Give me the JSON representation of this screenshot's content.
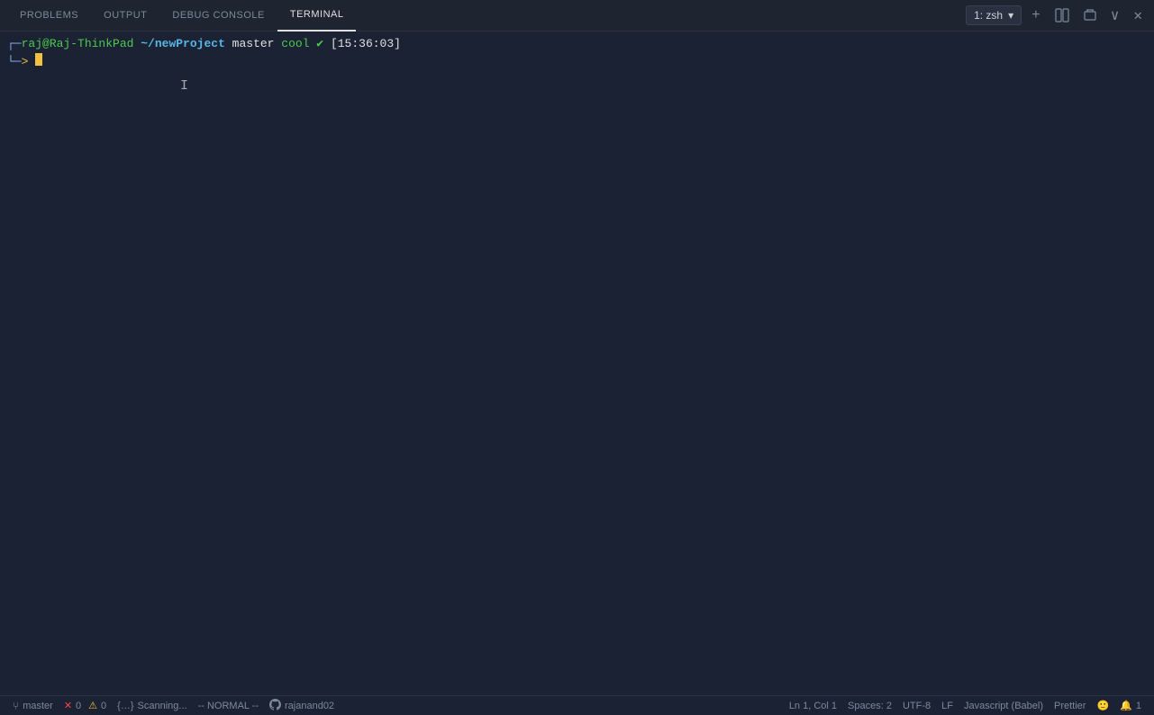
{
  "tabs": [
    {
      "id": "problems",
      "label": "PROBLEMS",
      "active": false
    },
    {
      "id": "output",
      "label": "OUTPUT",
      "active": false
    },
    {
      "id": "debug-console",
      "label": "DEBUG CONSOLE",
      "active": false
    },
    {
      "id": "terminal",
      "label": "TERMINAL",
      "active": true
    }
  ],
  "terminal_selector": {
    "label": "1: zsh",
    "icon": "chevron-down"
  },
  "toolbar_icons": {
    "add": "+",
    "split": "⧉",
    "trash": "🗑",
    "collapse": "∨",
    "close": "✕"
  },
  "terminal": {
    "prompt": {
      "bracket_open": "┌─",
      "user": "raj",
      "at": "@",
      "host": "Raj-ThinkPad",
      "path": " ~/newProject",
      "branch": " master",
      "cool": " cool",
      "checkmark": " ✔",
      "time": " [15:36:03]",
      "bracket_close": "",
      "arrow_line": "└─",
      "arrow": ">"
    }
  },
  "status_bar": {
    "git_branch": "master",
    "errors": "0",
    "warnings": "0",
    "scanning": "Scanning...",
    "vim_mode": "-- NORMAL --",
    "github_user": "rajanand02",
    "cursor_position": "Ln 1, Col 1",
    "spaces": "Spaces: 2",
    "encoding": "UTF-8",
    "line_ending": "LF",
    "language": "Javascript (Babel)",
    "formatter": "Prettier",
    "emoji": "🙂",
    "notifications": "1"
  }
}
